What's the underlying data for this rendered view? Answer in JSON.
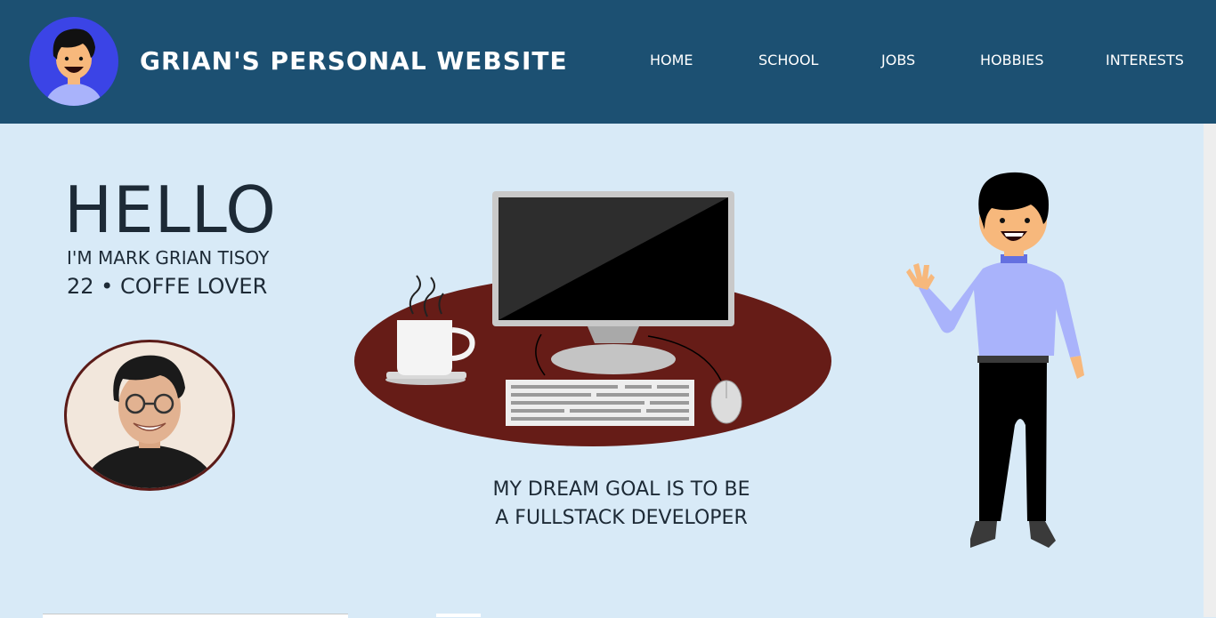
{
  "header": {
    "title": "GRIAN'S PERSONAL WEBSITE",
    "nav": [
      "HOME",
      "SCHOOL",
      "JOBS",
      "HOBBIES",
      "INTERESTS"
    ],
    "background": "#1c5072"
  },
  "hero": {
    "greeting": "HELLO",
    "name_line": "I'M MARK GRIAN TISOY",
    "age_line": "22 • COFFE LOVER",
    "dream_line1": "MY DREAM GOAL IS TO BE",
    "dream_line2": "A FULLSTACK DEVELOPER"
  },
  "colors": {
    "page_bg": "#d8eaf7",
    "text": "#1d2a36",
    "desk": "#661c17",
    "avatar_bg": "#3b44e6",
    "shirt": "#a9b3fb"
  }
}
